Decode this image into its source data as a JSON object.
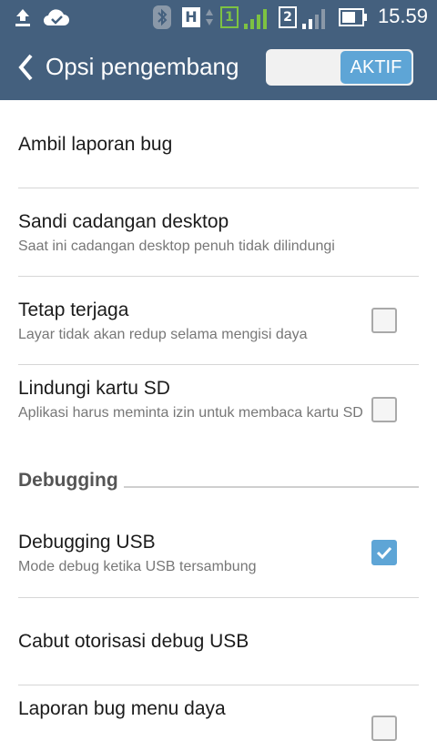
{
  "status_bar": {
    "time": "15.59",
    "icons": [
      "upload-icon",
      "cloud-check-icon",
      "bluetooth-icon",
      "network-h-icon",
      "sim1-signal-icon",
      "sim2-signal-icon",
      "battery-icon"
    ],
    "network_label": "H",
    "sim1_label": "1",
    "sim2_label": "2"
  },
  "app_bar": {
    "title": "Opsi pengembang",
    "toggle_label": "AKTIF",
    "colors": {
      "bar": "#44607e",
      "accent": "#5ea5d6",
      "sim1": "#7dc242"
    }
  },
  "items": [
    {
      "title": "Ambil laporan bug",
      "subtitle": ""
    },
    {
      "title": "Sandi cadangan desktop",
      "subtitle": "Saat ini cadangan desktop penuh tidak dilindungi"
    },
    {
      "title": "Tetap terjaga",
      "subtitle": "Layar tidak akan redup selama mengisi daya",
      "checked": false
    },
    {
      "title": "Lindungi kartu SD",
      "subtitle": "Aplikasi harus meminta izin untuk membaca kartu SD",
      "checked": false
    }
  ],
  "section": {
    "title": "Debugging"
  },
  "debug_items": [
    {
      "title": "Debugging USB",
      "subtitle": "Mode debug ketika USB tersambung",
      "checked": true
    },
    {
      "title": "Cabut otorisasi debug USB",
      "subtitle": ""
    },
    {
      "title": "Laporan bug menu daya",
      "subtitle": "",
      "checked": false
    }
  ]
}
